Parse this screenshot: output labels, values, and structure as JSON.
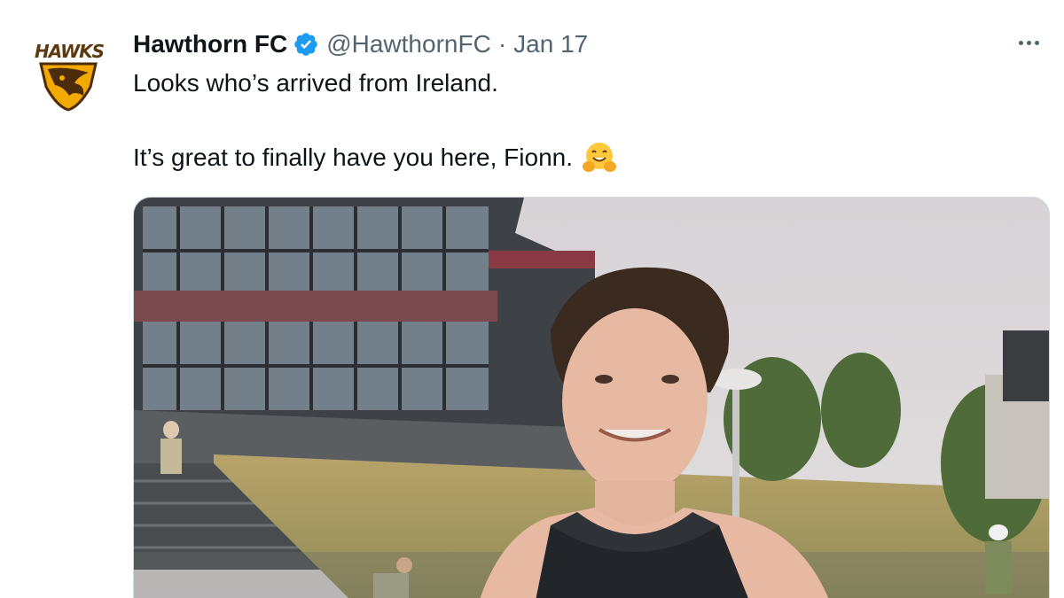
{
  "tweet": {
    "display_name": "Hawthorn FC",
    "handle": "@HawthornFC",
    "separator": "·",
    "date": "Jan 17",
    "text_line1": "Looks who’s arrived from Ireland.",
    "text_line2": "It’s great to finally have you here, Fionn.",
    "emoji": "hugging-face-emoji",
    "avatar_wordmark": "HAWKS"
  },
  "icons": {
    "verified": "verified-badge-icon",
    "more": "more-options-icon"
  },
  "colors": {
    "verified_blue": "#1d9bf0",
    "secondary_text": "#536471",
    "primary_text": "#0f1419",
    "hawks_brown": "#4d2c0b",
    "hawks_gold": "#f2a900"
  }
}
